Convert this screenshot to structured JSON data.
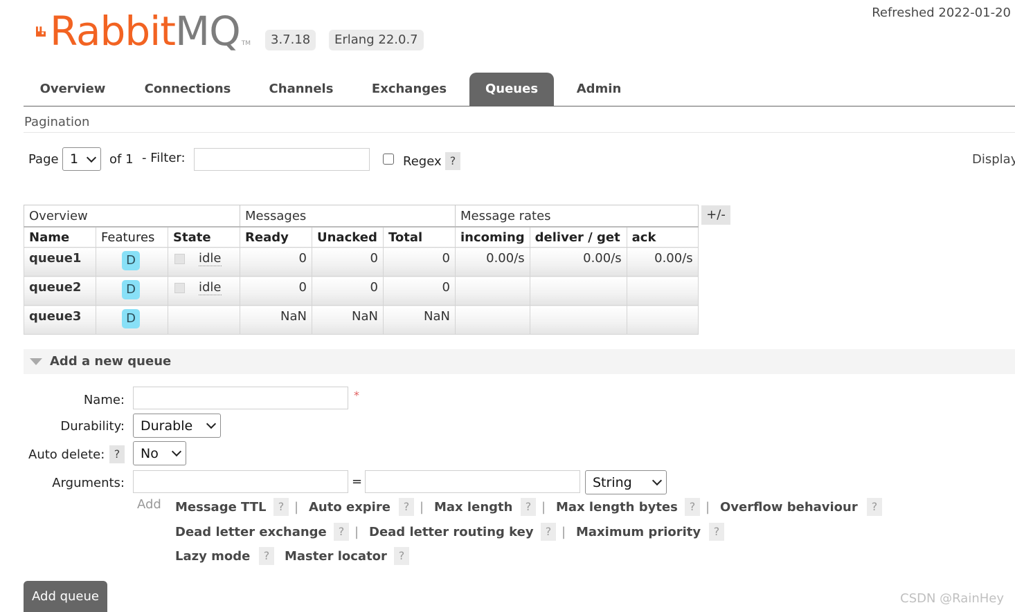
{
  "header": {
    "logo_text_rabbit": "Rabbit",
    "logo_text_mq": "MQ",
    "logo_tm": "TM",
    "version": "3.7.18",
    "erlang": "Erlang 22.0.7",
    "refreshed": "Refreshed 2022-01-20"
  },
  "nav": {
    "tabs": [
      "Overview",
      "Connections",
      "Channels",
      "Exchanges",
      "Queues",
      "Admin"
    ],
    "active": "Queues"
  },
  "pagination": {
    "title": "Pagination",
    "page_label": "Page",
    "page_value": "1",
    "of_label": "of 1",
    "filter_label": "- Filter:",
    "filter_value": "",
    "regex_label": "Regex",
    "help": "?",
    "display_label": "Display"
  },
  "table": {
    "groups": [
      "Overview",
      "Messages",
      "Message rates"
    ],
    "columns": [
      "Name",
      "Features",
      "State",
      "Ready",
      "Unacked",
      "Total",
      "incoming",
      "deliver / get",
      "ack"
    ],
    "plus_minus": "+/-",
    "rows": [
      {
        "name": "queue1",
        "feature": "D",
        "state": "idle",
        "ready": "0",
        "unacked": "0",
        "total": "0",
        "incoming": "0.00/s",
        "deliver": "0.00/s",
        "ack": "0.00/s"
      },
      {
        "name": "queue2",
        "feature": "D",
        "state": "idle",
        "ready": "0",
        "unacked": "0",
        "total": "0",
        "incoming": "",
        "deliver": "",
        "ack": ""
      },
      {
        "name": "queue3",
        "feature": "D",
        "state": "",
        "ready": "NaN",
        "unacked": "NaN",
        "total": "NaN",
        "incoming": "",
        "deliver": "",
        "ack": ""
      }
    ]
  },
  "add_queue": {
    "title": "Add a new queue",
    "name_label": "Name:",
    "name_value": "",
    "required_mark": "*",
    "durability_label": "Durability:",
    "durability_value": "Durable",
    "auto_delete_label": "Auto delete:",
    "auto_delete_value": "No",
    "arguments_label": "Arguments:",
    "equals": "=",
    "arg_type_value": "String",
    "add_link": "Add",
    "help": "?",
    "pipe": "|",
    "arg_keys": [
      "Message TTL",
      "Auto expire",
      "Max length",
      "Max length bytes",
      "Overflow behaviour",
      "Dead letter exchange",
      "Dead letter routing key",
      "Maximum priority",
      "Lazy mode",
      "Master locator"
    ],
    "submit": "Add queue"
  },
  "watermark": "CSDN @RainHey",
  "colors": {
    "brand_orange": "#f26322",
    "nav_active": "#666666",
    "durable_badge": "#88e0f7"
  }
}
